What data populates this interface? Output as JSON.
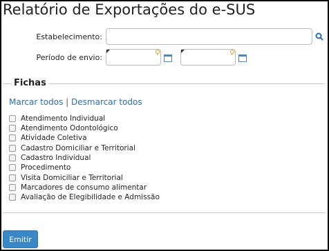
{
  "page": {
    "title": "Relatório de Exportações do e-SUS"
  },
  "form": {
    "estabelecimento_label": "Estabelecimento:",
    "estabelecimento_value": "",
    "periodo_label": "Período de envio:",
    "periodo_inicio_value": "",
    "periodo_fim_value": ""
  },
  "fichas": {
    "legend": "Fichas",
    "marcar_todos": "Marcar todos",
    "separator": "|",
    "desmarcar_todos": "Desmarcar todos",
    "items": [
      {
        "label": "Atendimento Individual",
        "checked": false
      },
      {
        "label": "Atendimento Odontológico",
        "checked": false
      },
      {
        "label": "Atividade Coletiva",
        "checked": false
      },
      {
        "label": "Cadastro Domiciliar e Territorial",
        "checked": false
      },
      {
        "label": "Cadastro Individual",
        "checked": false
      },
      {
        "label": "Procedimento",
        "checked": false
      },
      {
        "label": "Visita Domiciliar e Territorial",
        "checked": false
      },
      {
        "label": "Marcadores de consumo alimentar",
        "checked": false
      },
      {
        "label": "Avaliação de Elegibilidade e Admissão",
        "checked": false
      }
    ]
  },
  "actions": {
    "emitir_label": "Emitir"
  },
  "colors": {
    "accent": "#3a87c8",
    "link": "#2a6fb5",
    "warning": "#e0a030"
  },
  "icons": {
    "search": "search-icon",
    "calendar": "calendar-icon",
    "required": "warning-icon"
  }
}
